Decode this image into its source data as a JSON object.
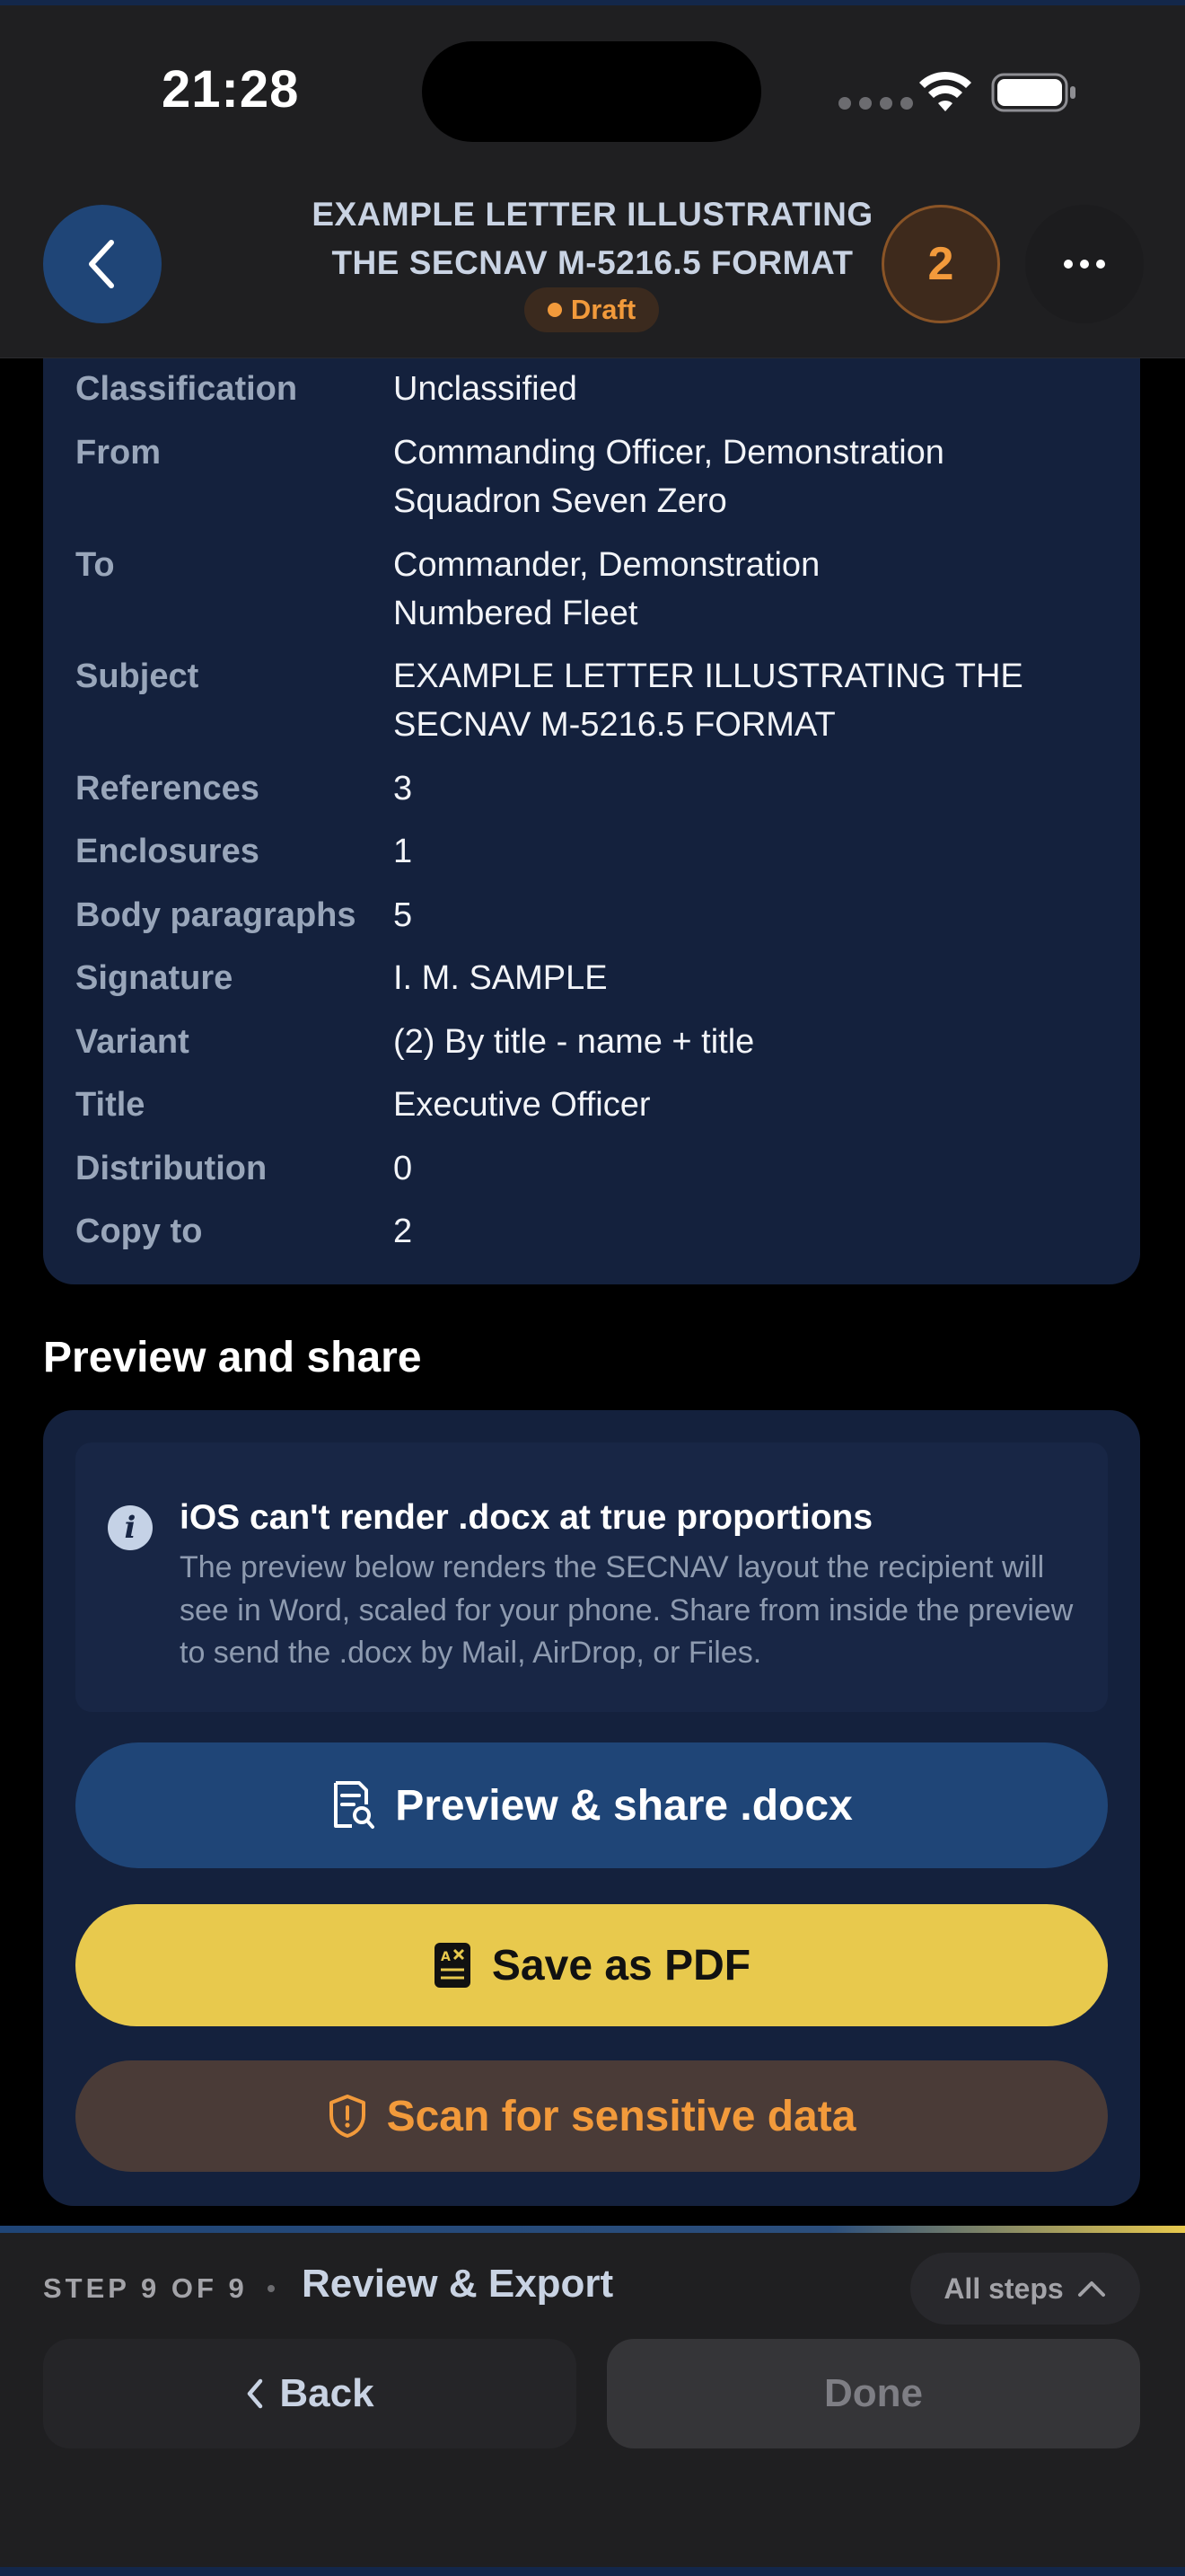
{
  "status_bar": {
    "time": "21:28"
  },
  "header": {
    "title_line1": "EXAMPLE LETTER ILLUSTRATING",
    "title_line2": "THE SECNAV M-5216.5 FORMAT",
    "status": "Draft",
    "count": "2",
    "back_icon": "chevron-left-icon",
    "more_icon": "ellipsis-icon"
  },
  "summary": {
    "rows": [
      {
        "label": "Classification",
        "value": "Unclassified"
      },
      {
        "label": "From",
        "value": "Commanding Officer, Demonstration",
        "value2": "Squadron Seven Zero"
      },
      {
        "label": "To",
        "value": "Commander, Demonstration",
        "value2": "Numbered Fleet"
      },
      {
        "label": "Subject",
        "value": "EXAMPLE LETTER ILLUSTRATING THE",
        "value2": "SECNAV M-5216.5 FORMAT"
      },
      {
        "label": "References",
        "value": "3"
      },
      {
        "label": "Enclosures",
        "value": "1"
      },
      {
        "label": "Body paragraphs",
        "value": "5"
      },
      {
        "label": "Signature",
        "value": "I. M. SAMPLE"
      },
      {
        "label": "Variant",
        "value": "(2) By title - name + title"
      },
      {
        "label": "Title",
        "value": "Executive Officer"
      },
      {
        "label": "Distribution",
        "value": "0"
      },
      {
        "label": "Copy to",
        "value": "2"
      }
    ]
  },
  "preview": {
    "heading": "Preview and share",
    "notice_title": "iOS can't render .docx at true proportions",
    "notice_body": "The preview below renders the SECNAV layout the recipient will see in Word, scaled for your phone. Share from inside the preview to send the .docx by Mail, AirDrop, or Files.",
    "preview_button": "Preview & share .docx",
    "pdf_button": "Save as PDF",
    "scan_button": "Scan for sensitive data",
    "colors": {
      "primary": "#1f4577",
      "pdf": "#e8c94d",
      "warning": "#f29a3b"
    }
  },
  "footer": {
    "step": "STEP 9 OF 9",
    "step_name": "Review & Export",
    "all_steps": "All steps",
    "back": "Back",
    "done": "Done"
  }
}
